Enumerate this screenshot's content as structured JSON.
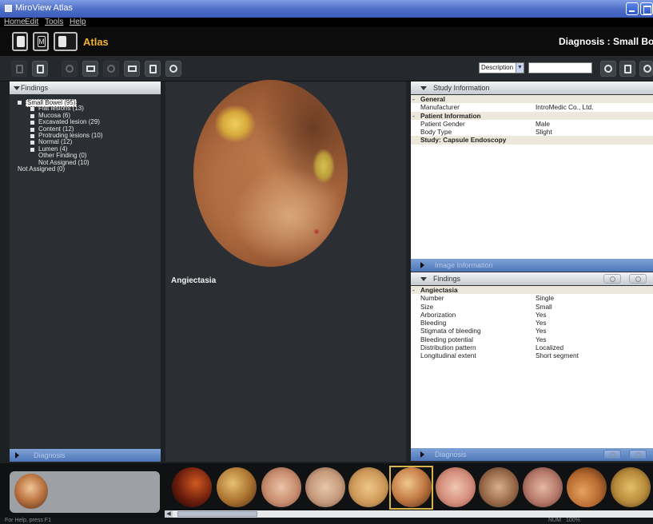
{
  "window": {
    "title": "MiroView Atlas"
  },
  "menu": [
    "Home",
    "Edit",
    "Tools",
    "Help"
  ],
  "header": {
    "module": "Atlas",
    "diagnosis_title": "Diagnosis : Small Bowe"
  },
  "toolbar": {
    "description_select": "Description",
    "search_value": ""
  },
  "findings_pane": {
    "title": "Findings",
    "tree": [
      {
        "label": "Small Bowel (95)",
        "level": 0,
        "expander": true,
        "selected": true
      },
      {
        "label": "Flat lesions (13)",
        "level": 1,
        "expander": true
      },
      {
        "label": "Mucosa (6)",
        "level": 1,
        "expander": true
      },
      {
        "label": "Excavated lesion (29)",
        "level": 1,
        "expander": true
      },
      {
        "label": "Content (12)",
        "level": 1,
        "expander": true
      },
      {
        "label": "Protruding lesions (10)",
        "level": 1,
        "expander": true
      },
      {
        "label": "Normal (12)",
        "level": 1,
        "expander": true
      },
      {
        "label": "Lumen (4)",
        "level": 1,
        "expander": true
      },
      {
        "label": "Other Finding (0)",
        "level": 1,
        "expander": false
      },
      {
        "label": "Not Assigned (10)",
        "level": 1,
        "expander": false
      },
      {
        "label": "Not Assigned (0)",
        "level": 0,
        "expander": false
      }
    ],
    "footer": "Diagnosis"
  },
  "center": {
    "image_caption": "Angiectasia"
  },
  "study_info": {
    "title": "Study Information",
    "rows": [
      {
        "type": "category",
        "key": "General"
      },
      {
        "type": "row",
        "key": "Manufacturer",
        "value": "IntroMedic Co., Ltd."
      },
      {
        "type": "category",
        "key": "Patient Information"
      },
      {
        "type": "row",
        "key": "Patient Gender",
        "value": "Male"
      },
      {
        "type": "row",
        "key": "Body Type",
        "value": "Slight"
      },
      {
        "type": "category2",
        "key": "Study: Capsule Endoscopy"
      }
    ],
    "image_info_label": "Image Information"
  },
  "findings_detail": {
    "title": "Findings",
    "category": "Angiectasia",
    "rows": [
      {
        "key": "Number",
        "value": "Single"
      },
      {
        "key": "Size",
        "value": "Small"
      },
      {
        "key": "Arborization",
        "value": "Yes"
      },
      {
        "key": "Bleeding",
        "value": "Yes"
      },
      {
        "key": "Stigmata of bleeding",
        "value": "Yes"
      },
      {
        "key": "Bleeding potential",
        "value": "Yes"
      },
      {
        "key": "Distribution pattern",
        "value": "Localized"
      },
      {
        "key": "Longitudinal extent",
        "value": "Short segment"
      }
    ],
    "footer": "Diagnosis"
  },
  "filmstrip": {
    "thumbnail_count": 12,
    "selected_index": 6
  },
  "statusbar": {
    "help": "For Help, press F1",
    "num": "NUM",
    "zoom": "100%"
  }
}
